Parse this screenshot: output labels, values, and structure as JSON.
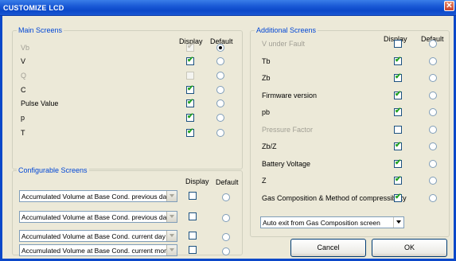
{
  "window": {
    "title": "CUSTOMIZE LCD",
    "close_glyph": "✕"
  },
  "main_screens": {
    "legend": "Main Screens",
    "col_display": "Display",
    "col_default": "Default",
    "rows": [
      {
        "label": "Vb",
        "enabled": false,
        "display": true,
        "default": true
      },
      {
        "label": "V",
        "enabled": true,
        "display": true,
        "default": false
      },
      {
        "label": "Q",
        "enabled": false,
        "display": false,
        "default": false
      },
      {
        "label": "C",
        "enabled": true,
        "display": true,
        "default": false
      },
      {
        "label": "Pulse Value",
        "enabled": true,
        "display": true,
        "default": false
      },
      {
        "label": "p",
        "enabled": true,
        "display": true,
        "default": false
      },
      {
        "label": "T",
        "enabled": true,
        "display": true,
        "default": false
      }
    ]
  },
  "configurable_screens": {
    "legend": "Configurable Screens",
    "col_display": "Display",
    "col_default": "Default",
    "rows": [
      {
        "value": "Accumulated Volume at Base Cond. previous day",
        "display": false,
        "default": false
      },
      {
        "value": "Accumulated Volume at Base Cond. previous day",
        "display": false,
        "default": false
      },
      {
        "value": "Accumulated Volume at Base Cond. current day",
        "display": false,
        "default": false
      },
      {
        "value": "Accumulated Volume at Base Cond. current montl",
        "display": false,
        "default": false
      }
    ]
  },
  "additional_screens": {
    "legend": "Additional Screens",
    "col_display": "Display",
    "col_default": "Default",
    "rows": [
      {
        "label": "V under Fault",
        "enabled": false,
        "display": false,
        "default": false
      },
      {
        "label": "Tb",
        "enabled": true,
        "display": true,
        "default": false
      },
      {
        "label": "Zb",
        "enabled": true,
        "display": true,
        "default": false
      },
      {
        "label": "Firmware version",
        "enabled": true,
        "display": true,
        "default": false
      },
      {
        "label": "pb",
        "enabled": true,
        "display": true,
        "default": false
      },
      {
        "label": "Pressure Factor",
        "enabled": false,
        "display": false,
        "default": false
      },
      {
        "label": "Zb/Z",
        "enabled": true,
        "display": true,
        "default": false
      },
      {
        "label": "Battery Voltage",
        "enabled": true,
        "display": true,
        "default": false
      },
      {
        "label": "Z",
        "enabled": true,
        "display": true,
        "default": false
      },
      {
        "label": "Gas Composition & Method of compressibility",
        "enabled": true,
        "display": true,
        "default": false
      }
    ],
    "auto_exit_select": "Auto exit from Gas Composition screen"
  },
  "buttons": {
    "cancel": "Cancel",
    "ok": "OK"
  },
  "check_glyph": "✔"
}
